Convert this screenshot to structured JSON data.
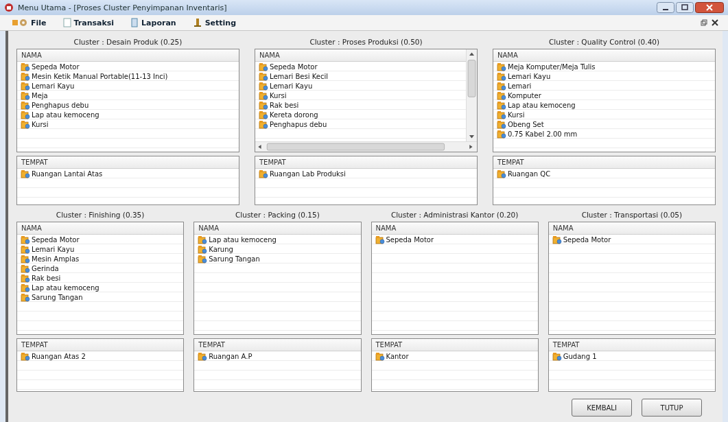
{
  "window": {
    "title": "Menu Utama - [Proses Cluster Penyimpanan Inventaris]"
  },
  "menu": [
    {
      "label": "File"
    },
    {
      "label": "Transaksi"
    },
    {
      "label": "Laporan"
    },
    {
      "label": "Setting"
    }
  ],
  "clusters": [
    {
      "title": "Cluster : Desain Produk (0.25)",
      "nama_header": "NAMA",
      "nama": [
        "Sepeda Motor",
        "Mesin Ketik Manual Portable(11-13 Inci)",
        "Lemari Kayu",
        "Meja",
        "Penghapus debu",
        "Lap atau kemoceng",
        "Kursi"
      ],
      "tempat_header": "TEMPAT",
      "tempat": [
        "Ruangan Lantai Atas"
      ],
      "scrollbars": false
    },
    {
      "title": "Cluster : Proses Produksi (0.50)",
      "nama_header": "NAMA",
      "nama": [
        "Sepeda Motor",
        "Lemari Besi Kecil",
        "Lemari Kayu",
        "Kursi",
        "Rak besi",
        "Kereta dorong",
        "Penghapus debu"
      ],
      "tempat_header": "TEMPAT",
      "tempat": [
        "Ruangan Lab Produksi"
      ],
      "scrollbars": true
    },
    {
      "title": "Cluster : Quality Control (0.40)",
      "nama_header": "NAMA",
      "nama": [
        "Meja Komputer/Meja Tulis",
        "Lemari Kayu",
        "Lemari",
        "Komputer",
        "Lap atau kemoceng",
        "Kursi",
        "Obeng Set",
        "0.75 Kabel 2.00 mm"
      ],
      "tempat_header": "TEMPAT",
      "tempat": [
        "Ruangan QC"
      ],
      "scrollbars": false
    },
    {
      "title": "Cluster : Finishing (0.35)",
      "nama_header": "NAMA",
      "nama": [
        "Sepeda Motor",
        "Lemari Kayu",
        "Mesin Amplas",
        "Gerinda",
        "Rak besi",
        "Lap atau kemoceng",
        "Sarung Tangan"
      ],
      "tempat_header": "TEMPAT",
      "tempat": [
        "Ruangan Atas 2"
      ],
      "scrollbars": false
    },
    {
      "title": "Cluster : Packing (0.15)",
      "nama_header": "NAMA",
      "nama": [
        "Lap atau kemoceng",
        "Karung",
        "Sarung Tangan"
      ],
      "tempat_header": "TEMPAT",
      "tempat": [
        "Ruangan A.P"
      ],
      "scrollbars": false
    },
    {
      "title": "Cluster : Administrasi Kantor (0.20)",
      "nama_header": "NAMA",
      "nama": [
        "Sepeda Motor"
      ],
      "tempat_header": "TEMPAT",
      "tempat": [
        "Kantor"
      ],
      "scrollbars": false
    },
    {
      "title": "Cluster : Transportasi (0.05)",
      "nama_header": "NAMA",
      "nama": [
        "Sepeda Motor"
      ],
      "tempat_header": "TEMPAT",
      "tempat": [
        "Gudang 1"
      ],
      "scrollbars": false
    }
  ],
  "buttons": [
    {
      "label": "KEMBALI"
    },
    {
      "label": "TUTUP"
    }
  ]
}
